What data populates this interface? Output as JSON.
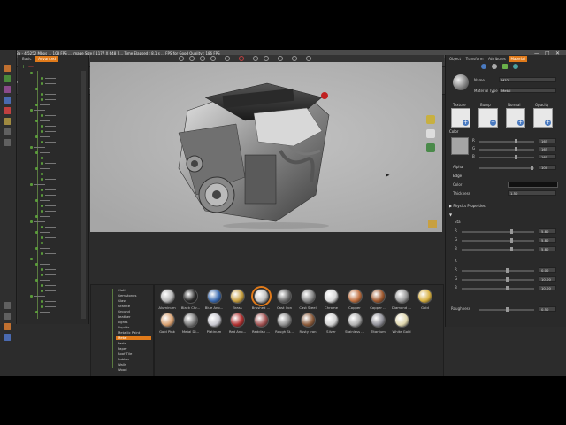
{
  "titlebar": {
    "title": "KAB 8a - 4,5252 Mbps ... 108 FPS ... Image Size [ 1177 X 648 ] ... Time Elapsed : 8.1 s ... FPS for Good Quality : 186 FPS",
    "minimize": "—",
    "maximize": "□",
    "close": "✕"
  },
  "tabs": [
    {
      "label": "File",
      "active": false
    },
    {
      "label": "Object",
      "active": false
    },
    {
      "label": "Move",
      "active": false
    },
    {
      "label": "Material",
      "active": true
    },
    {
      "label": "Camera",
      "active": false
    },
    {
      "label": "Light",
      "active": false
    },
    {
      "label": "Create",
      "active": false
    },
    {
      "label": "Geometry",
      "active": false
    },
    {
      "label": "Texture Coordinates",
      "active": false
    },
    {
      "label": "Scene States",
      "active": false
    }
  ],
  "right_tabs": [
    {
      "label": "Animation",
      "active": true
    },
    {
      "label": "Scene States",
      "active": false
    },
    {
      "label": "Sharing Resources",
      "active": false
    }
  ],
  "toolbar": {
    "buttons": [
      {
        "label": "Show Materials",
        "color": "#c98a30"
      },
      {
        "label": "Add",
        "color": "#6a9ac8"
      },
      {
        "label": "Delete Unused",
        "color": "#c04040"
      },
      {
        "label": "Save as library",
        "color": "#8a8a8a"
      },
      {
        "label": "Retain from library",
        "color": "#8a8a8a"
      },
      {
        "label": "Manage",
        "color": "#8a8a8a"
      },
      {
        "label": "Regenerate Library",
        "color": "#8a8a8a"
      },
      {
        "label": "Style Only",
        "color": "#8a8a8a"
      }
    ],
    "current_library_label": "Current library:",
    "current_library_value": "Composer",
    "groups": [
      "Scene",
      "Library",
      "On Drop"
    ]
  },
  "left_panel": {
    "tabs": [
      {
        "label": "Basic",
        "active": false
      },
      {
        "label": "Advanced",
        "active": true
      }
    ],
    "add_label": "+",
    "remove_label": "—"
  },
  "categories": [
    {
      "label": "Cloth",
      "active": false
    },
    {
      "label": "Gemstones",
      "active": false
    },
    {
      "label": "Glass",
      "active": false
    },
    {
      "label": "Granite",
      "active": false
    },
    {
      "label": "Ground",
      "active": false
    },
    {
      "label": "Leather",
      "active": false
    },
    {
      "label": "Lights",
      "active": false
    },
    {
      "label": "Liquids",
      "active": false
    },
    {
      "label": "Metallic Paint",
      "active": false
    },
    {
      "label": "Metal",
      "active": true
    },
    {
      "label": "Paste",
      "active": false
    },
    {
      "label": "Paper",
      "active": false
    },
    {
      "label": "Roof Tile",
      "active": false
    },
    {
      "label": "Rubber",
      "active": false
    },
    {
      "label": "Walls",
      "active": false
    },
    {
      "label": "Wood",
      "active": false
    }
  ],
  "materials": [
    {
      "name": "Aluminum",
      "color": "#b8b8b8"
    },
    {
      "name": "Black Chr...",
      "color": "#2a2a2a"
    },
    {
      "name": "Blue Ano...",
      "color": "#3a6ab0"
    },
    {
      "name": "Brass",
      "color": "#c8a040"
    },
    {
      "name": "Brushed ...",
      "color": "#c0c0c0"
    },
    {
      "name": "Cast Iron",
      "color": "#6a6a6a"
    },
    {
      "name": "Cast Steel",
      "color": "#8a8a8a"
    },
    {
      "name": "Chrome",
      "color": "#d8d8d8"
    },
    {
      "name": "Copper",
      "color": "#c07040"
    },
    {
      "name": "Copper ...",
      "color": "#a05a30"
    },
    {
      "name": "Diamond ...",
      "color": "#9a9a9a"
    },
    {
      "name": "Gold",
      "color": "#d8b040"
    },
    {
      "name": "Gold Pink",
      "color": "#d8a070"
    },
    {
      "name": "Metal Di...",
      "color": "#7a7a7a"
    },
    {
      "name": "Platinum",
      "color": "#c8c8d0"
    },
    {
      "name": "Red Ano...",
      "color": "#b03030"
    },
    {
      "name": "Reddish ...",
      "color": "#a05050"
    },
    {
      "name": "Rough St...",
      "color": "#909090"
    },
    {
      "name": "Rusty Iron",
      "color": "#8a5a3a"
    },
    {
      "name": "Silver",
      "color": "#d0d0d0"
    },
    {
      "name": "Stainless ...",
      "color": "#b0b0b0"
    },
    {
      "name": "Titanium",
      "color": "#909098"
    },
    {
      "name": "White Gold",
      "color": "#e0d8b0"
    }
  ],
  "right_panel": {
    "tabs": [
      {
        "label": "Object",
        "active": false
      },
      {
        "label": "Transform",
        "active": false
      },
      {
        "label": "Attributes",
        "active": false
      },
      {
        "label": "Material",
        "active": true
      }
    ],
    "name_label": "Name",
    "name_value": "M32",
    "material_type_label": "Material Type",
    "material_type_value": "Metal",
    "maps": [
      "Texture",
      "Bump",
      "Normal",
      "Opacity"
    ],
    "color_label": "Color",
    "r_label": "R",
    "g_label": "G",
    "b_label": "B",
    "r_value": "165",
    "g_value": "165",
    "b_value": "165",
    "alpha_label": "Alpha",
    "alpha_value": "100",
    "edge_label": "Edge",
    "edge_color_label": "Color",
    "thickness_label": "Thickness",
    "thickness_value": "1.50",
    "physics_label": "Physics Properties",
    "eta_label": "Eta",
    "k_label": "K",
    "eta_r": "5.80",
    "eta_g": "5.80",
    "eta_b": "5.80",
    "k_r": "0.00",
    "k_g": "10.00",
    "k_b": "10.00",
    "roughness_label": "Roughness",
    "roughness_value": "0.50"
  }
}
